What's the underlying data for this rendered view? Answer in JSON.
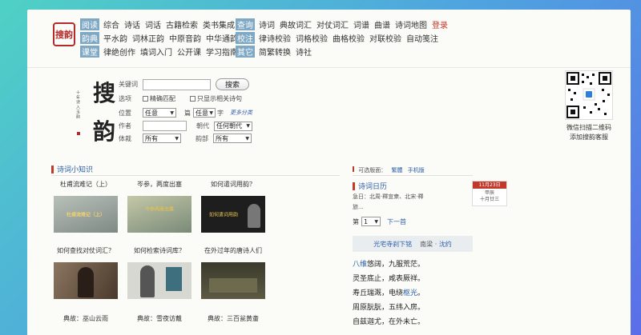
{
  "logo_text": "搜韵",
  "nav_left": [
    {
      "tag": "阅读",
      "links": [
        "综合",
        "诗话",
        "词话",
        "古籍检索",
        "类书集成"
      ]
    },
    {
      "tag": "韵典",
      "links": [
        "平水韵",
        "词林正韵",
        "中原音韵",
        "中华通韵"
      ]
    },
    {
      "tag": "课堂",
      "links": [
        "律绝创作",
        "填词入门",
        "公开课",
        "学习指南"
      ]
    }
  ],
  "nav_right": [
    {
      "tag": "查询",
      "links": [
        "诗词",
        "典故词汇",
        "对仗词汇",
        "词谱",
        "曲谱",
        "诗词地图"
      ],
      "login": "登录"
    },
    {
      "tag": "校注",
      "links": [
        "律诗校验",
        "词格校验",
        "曲格校验",
        "对联校验",
        "自动笺注"
      ]
    },
    {
      "tag": "其它",
      "links": [
        "简繁转换",
        "诗社"
      ]
    }
  ],
  "calligraphy": {
    "char1": "搜",
    "char2": "韵",
    "inscription": "十年诗入玉韵"
  },
  "search": {
    "keyword_label": "关键词",
    "keyword_value": "",
    "search_button": "搜索",
    "options_label": "选项",
    "exact_match": "精确匹配",
    "only_related": "只显示相关诗句",
    "position_label": "位置",
    "position_value": "任意",
    "article_label": "篇",
    "char_select_value": "任意",
    "char_label": "字",
    "more_categories": "更多分类",
    "author_label": "作者",
    "author_value": "",
    "dynasty_label": "朝代",
    "dynasty_value": "任何朝代",
    "form_label": "体裁",
    "form_value": "所有",
    "rhyme_label": "韵部",
    "rhyme_value": "所有"
  },
  "qr": {
    "caption_line1": "微信扫描二维码",
    "caption_line2": "添加搜韵客服"
  },
  "knowledge": {
    "title": "诗词小知识",
    "items": [
      {
        "caption": "杜甫流难记（上）",
        "overlay": "杜甫流难记（上）",
        "bg": "#9aa29c"
      },
      {
        "caption": "岑参，两度出塞",
        "overlay": "岑参两度出塞",
        "bg": "#a8ae98"
      },
      {
        "caption": "如何遣词用韵？",
        "overlay": "如何遣词用韵",
        "bg": "#2a2a2a"
      },
      {
        "caption": "如何查找对仗词汇？",
        "overlay": "",
        "bg": "#6b5a48"
      },
      {
        "caption": "如何检索诗词库？",
        "overlay": "",
        "bg": "#c9c9c4"
      },
      {
        "caption": "在外过年的唐诗人们",
        "overlay": "",
        "bg": "#4b4a3a"
      }
    ],
    "row3": [
      "典故：巫山云雨",
      "典故：雪夜访戴",
      "典故：三百瓮黄齑"
    ]
  },
  "right": {
    "version_label": "可选版面：",
    "version_links": [
      "繁體",
      "手机版"
    ],
    "calendar_title": "诗词日历",
    "calendar_date": "11月23日",
    "calendar_lunar1": "甲辰",
    "calendar_lunar2": "十月廿三",
    "calendar_text1": "急日：北周·釋宣衆、北宋·釋",
    "calendar_text2": "旅...",
    "page_label": "第",
    "page_value": "1",
    "page_suffix": "",
    "next_link": "下一首",
    "poem_title": "光宅寺刹下铭",
    "poem_dynasty": "南梁",
    "poem_author": "沈约",
    "poem_lines": [
      {
        "hl": "八维",
        "rest": "悠阔，九服荒茫。"
      },
      {
        "hl": "",
        "rest": "灵圣底止，咸表厥祥。"
      },
      {
        "hl": "",
        "rest": "寿丘瑞溉，电绕",
        "hl2": "枢光",
        "rest2": "。"
      },
      {
        "hl": "",
        "rest": "周原朊朊，五纬入房。"
      },
      {
        "hl": "",
        "rest": "自兹迦尤，在外未亡。"
      }
    ]
  }
}
